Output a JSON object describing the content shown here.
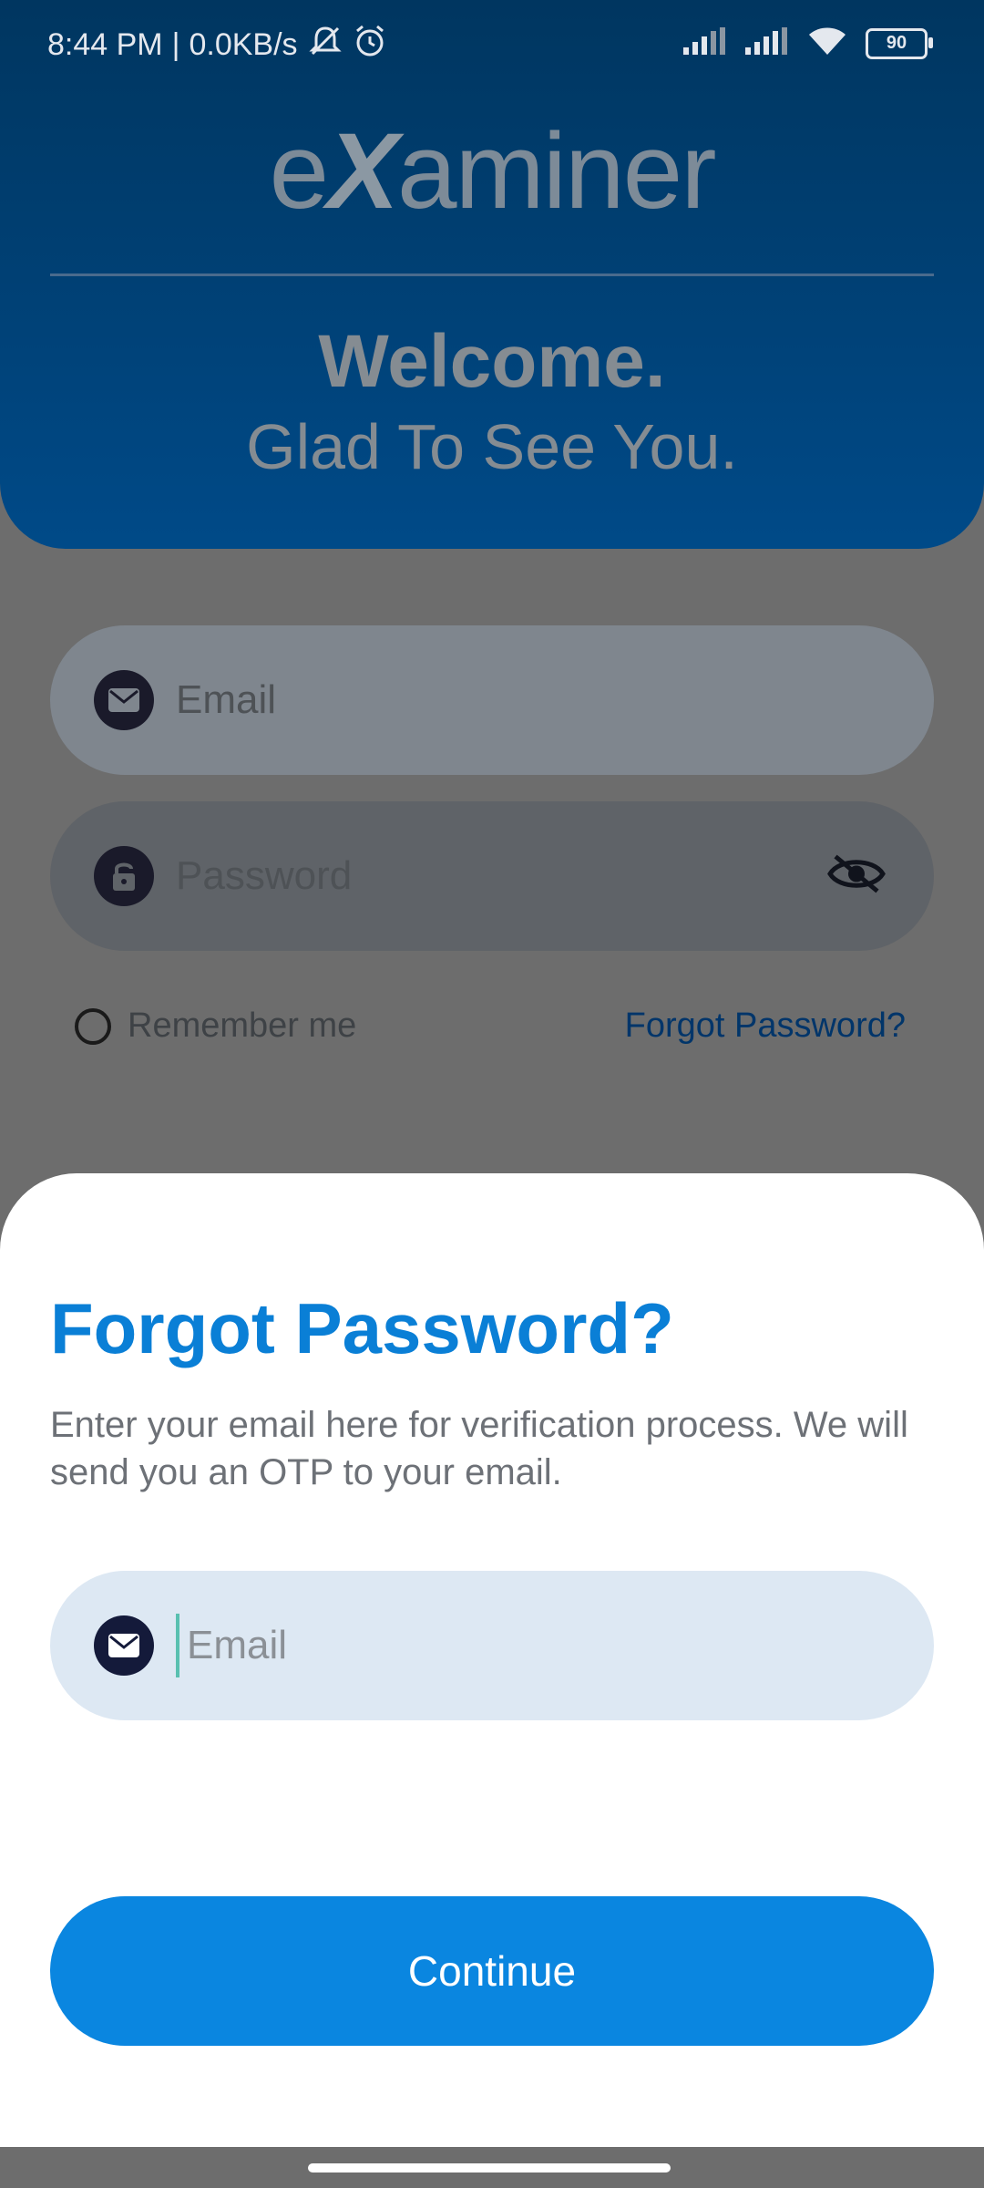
{
  "status_bar": {
    "time": "8:44 PM",
    "separator": "|",
    "network_speed": "0.0KB/s",
    "battery": "90",
    "icons": [
      "silent-icon",
      "alarm-icon",
      "signal-icon",
      "signal-icon",
      "wifi-icon",
      "battery-icon"
    ]
  },
  "header": {
    "logo_pre": "e",
    "logo_x": "X",
    "logo_post": "aminer",
    "welcome": "Welcome.",
    "subtitle": "Glad To See You."
  },
  "login_form": {
    "email_placeholder": "Email",
    "password_placeholder": "Password",
    "remember_label": "Remember me",
    "forgot_link": "Forgot Password?"
  },
  "sheet": {
    "title": "Forgot Password?",
    "description": "Enter your email here for verification process. We will send you an OTP to your email.",
    "email_placeholder": "Email",
    "email_value": "",
    "continue_label": "Continue"
  },
  "colors": {
    "header": "#003660",
    "accent": "#0a86e0",
    "title": "#0a7fd6",
    "field_bg": "#dde8f3"
  }
}
